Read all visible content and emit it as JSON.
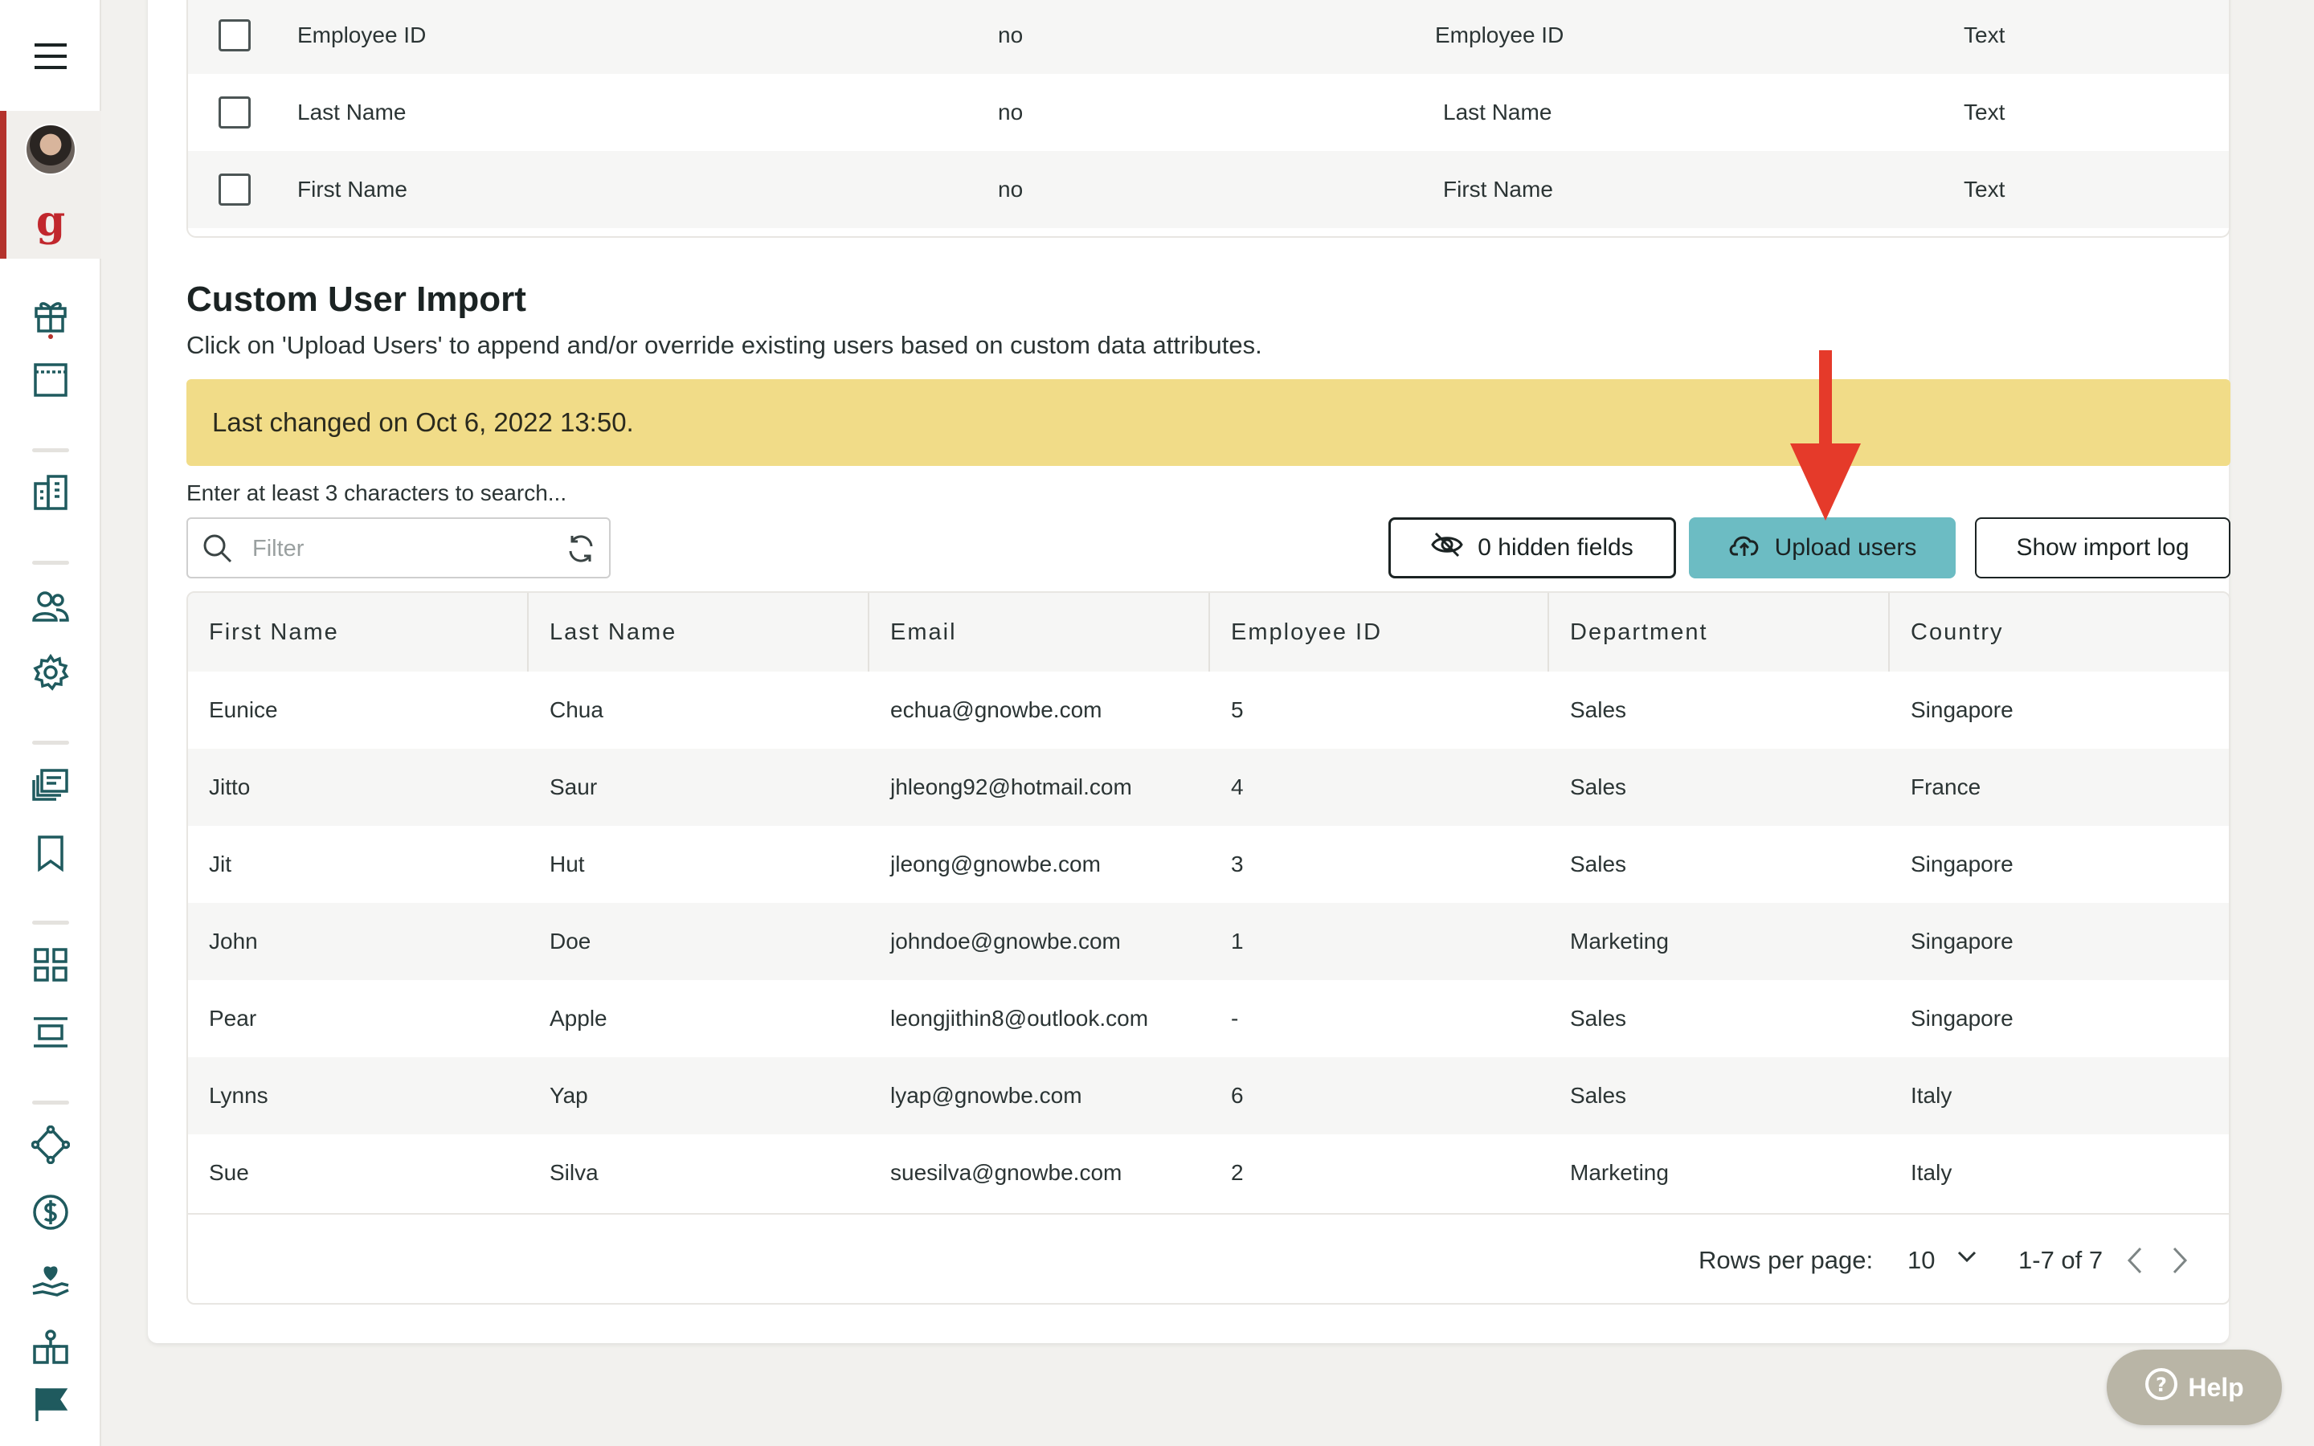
{
  "top_table": {
    "rows": [
      {
        "name": "Employee ID",
        "flag": "no",
        "mapped": "Employee ID",
        "type": "Text"
      },
      {
        "name": "Last Name",
        "flag": "no",
        "mapped": "Last Name",
        "type": "Text"
      },
      {
        "name": "First Name",
        "flag": "no",
        "mapped": "First Name",
        "type": "Text"
      }
    ]
  },
  "section": {
    "title": "Custom User Import",
    "description": "Click on 'Upload Users' to append and/or override existing users based on custom data attributes."
  },
  "banner": {
    "text": "Last changed on Oct 6, 2022 13:50.",
    "color": "#f1dc88"
  },
  "search": {
    "hint": "Enter at least 3 characters to search...",
    "placeholder": "Filter",
    "value": ""
  },
  "toolbar": {
    "hidden_fields_label": "0 hidden fields",
    "upload_label": "Upload users",
    "import_log_label": "Show import log"
  },
  "table": {
    "columns": [
      "First Name",
      "Last Name",
      "Email",
      "Employee ID",
      "Department",
      "Country"
    ],
    "rows": [
      [
        "Eunice",
        "Chua",
        "echua@gnowbe.com",
        "5",
        "Sales",
        "Singapore"
      ],
      [
        "Jitto",
        "Saur",
        "jhleong92@hotmail.com",
        "4",
        "Sales",
        "France"
      ],
      [
        "Jit",
        "Hut",
        "jleong@gnowbe.com",
        "3",
        "Sales",
        "Singapore"
      ],
      [
        "John",
        "Doe",
        "johndoe@gnowbe.com",
        "1",
        "Marketing",
        "Singapore"
      ],
      [
        "Pear",
        "Apple",
        "leongjithin8@outlook.com",
        "-",
        "Sales",
        "Singapore"
      ],
      [
        "Lynns",
        "Yap",
        "lyap@gnowbe.com",
        "6",
        "Sales",
        "Italy"
      ],
      [
        "Sue",
        "Silva",
        "suesilva@gnowbe.com",
        "2",
        "Marketing",
        "Italy"
      ]
    ]
  },
  "pagination": {
    "rows_per_page_label": "Rows per page:",
    "rows_per_page": "10",
    "range": "1-7 of 7"
  },
  "help": {
    "label": "Help"
  },
  "sidebar": {
    "logo": "g",
    "icons": [
      "gift-icon",
      "window-icon",
      "buildings-icon",
      "users-icon",
      "gear-icon",
      "library-icon",
      "bookmark-icon",
      "apps-grid-icon",
      "layout-icon",
      "network-icon",
      "dollar-icon",
      "heart-hand-icon",
      "org-chart-icon",
      "flag-icon"
    ]
  },
  "colors": {
    "accent": "#6cbcc3",
    "brand": "#c1272d",
    "annotation_arrow": "#e53a2a"
  }
}
